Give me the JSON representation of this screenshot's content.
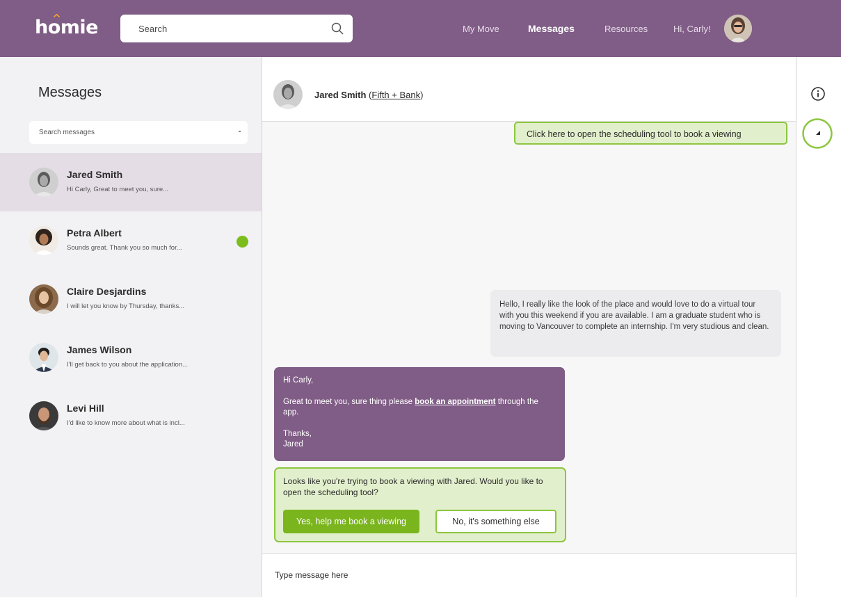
{
  "header": {
    "logo": "homie",
    "search_placeholder": "Search",
    "nav": [
      "My Move",
      "Messages",
      "Resources",
      "Hi, Carly!"
    ],
    "active_nav": "Messages"
  },
  "sidebar": {
    "title": "Messages",
    "search_placeholder": "Search messages",
    "conversations": [
      {
        "name": "Jared Smith",
        "preview": "Hi Carly, Great to meet you, sure...",
        "selected": true,
        "unread": false
      },
      {
        "name": "Petra Albert",
        "preview": "Sounds great. Thank you so much for...",
        "selected": false,
        "unread": true
      },
      {
        "name": "Claire Desjardins",
        "preview": "I will let you know by Thursday, thanks...",
        "selected": false,
        "unread": false
      },
      {
        "name": "James Wilson",
        "preview": "I'll get back to you about the application...",
        "selected": false,
        "unread": false
      },
      {
        "name": "Levi Hill",
        "preview": "I'd like to know more about what is incl...",
        "selected": false,
        "unread": false
      }
    ]
  },
  "chat": {
    "contact_name": "Jared Smith",
    "contact_company": "Fifth + Bank",
    "scheduling_hint": "Click here to open the scheduling tool to book a viewing",
    "outgoing_message": "Hello, I really like the look of the place and would love to do a virtual tour with you this weekend if you are available. I am a graduate student who is moving to Vancouver to complete an internship. I'm very studious and clean.",
    "incoming_message": {
      "greeting": "Hi Carly,",
      "body_before_link": "Great to meet you, sure thing please ",
      "link_text": "book an appointment",
      "body_after_link": " through the app.",
      "signoff": "Thanks,",
      "signature": "Jared"
    },
    "suggestion": {
      "text": "Looks like you're trying to book a viewing with Jared. Would you like to open the scheduling tool?",
      "yes_label": "Yes, help me book a viewing",
      "no_label": "No, it's something else"
    },
    "composer_placeholder": "Type message here"
  },
  "colors": {
    "brand_purple": "#805d86",
    "accent_green": "#8cc63f",
    "button_green": "#7ab51d",
    "hint_background": "#e2efcc"
  },
  "icons": [
    "search-icon",
    "info-icon",
    "scheduling-assistant-icon"
  ]
}
